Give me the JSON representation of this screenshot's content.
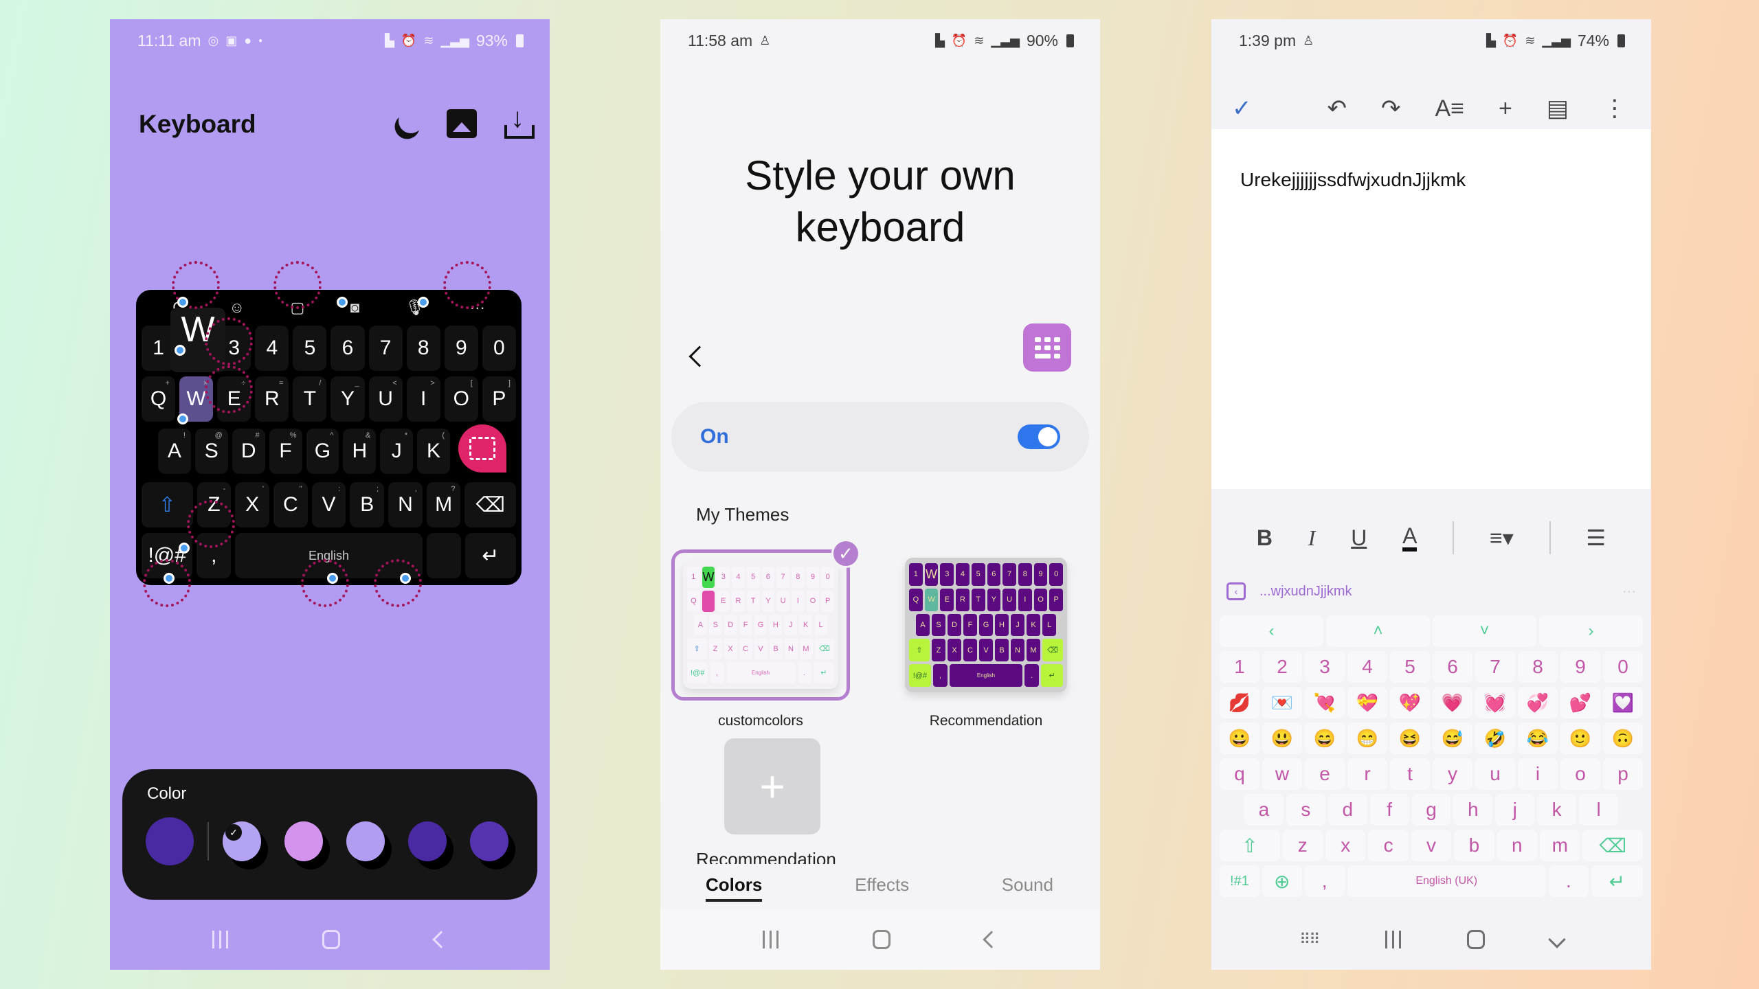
{
  "phone1": {
    "status": {
      "time": "11:11 am",
      "battery": "93%",
      "left_icons": [
        "whatsapp-icon",
        "gallery-icon",
        "chat-icon",
        "dot"
      ],
      "right_icons": [
        "sim-icon",
        "alarm-icon",
        "wifi-icon",
        "volte-lte1",
        "volte-lte2"
      ]
    },
    "title": "Keyboard",
    "actions": [
      "dark-mode",
      "background-image",
      "download"
    ],
    "preview_key": "W",
    "toolbar_icons": [
      "clipboard",
      "emoji",
      "sticker",
      "screenshot",
      "mic",
      "more"
    ],
    "rows": [
      [
        {
          "k": "1"
        },
        {
          "k": "2"
        },
        {
          "k": "3"
        },
        {
          "k": "4"
        },
        {
          "k": "5"
        },
        {
          "k": "6"
        },
        {
          "k": "7"
        },
        {
          "k": "8"
        },
        {
          "k": "9"
        },
        {
          "k": "0"
        }
      ],
      [
        {
          "k": "Q",
          "s": "+"
        },
        {
          "k": "W",
          "s": "×"
        },
        {
          "k": "E",
          "s": "÷"
        },
        {
          "k": "R",
          "s": "="
        },
        {
          "k": "T",
          "s": "/"
        },
        {
          "k": "Y",
          "s": "_"
        },
        {
          "k": "U",
          "s": "<"
        },
        {
          "k": "I",
          "s": ">"
        },
        {
          "k": "O",
          "s": "["
        },
        {
          "k": "P",
          "s": "]"
        }
      ],
      [
        {
          "k": "A",
          "s": "!"
        },
        {
          "k": "S",
          "s": "@"
        },
        {
          "k": "D",
          "s": "#"
        },
        {
          "k": "F",
          "s": "%"
        },
        {
          "k": "G",
          "s": "^"
        },
        {
          "k": "H",
          "s": "&"
        },
        {
          "k": "J",
          "s": "*"
        },
        {
          "k": "K",
          "s": "("
        }
      ],
      [
        {
          "k": "⇧"
        },
        {
          "k": "Z",
          "s": "-"
        },
        {
          "k": "X",
          "s": "'"
        },
        {
          "k": "C",
          "s": "\""
        },
        {
          "k": "V",
          "s": ":"
        },
        {
          "k": "B",
          "s": ";"
        },
        {
          "k": "N",
          "s": ","
        },
        {
          "k": "M",
          "s": "?"
        },
        {
          "k": "⌫"
        }
      ],
      [
        {
          "k": "!@#"
        },
        {
          "k": ","
        },
        {
          "k": "English"
        },
        {
          "k": ""
        },
        {
          "k": "↵"
        }
      ]
    ],
    "color_panel": {
      "label": "Color",
      "current": "#4a2aa3",
      "swatches": [
        {
          "color": "#b3a3f2",
          "selected": true
        },
        {
          "color": "#d393ee",
          "selected": false
        },
        {
          "color": "#b19ef2",
          "selected": false
        },
        {
          "color": "#4a2aa3",
          "selected": false
        },
        {
          "color": "#5532b0",
          "selected": false
        }
      ]
    }
  },
  "phone2": {
    "status": {
      "time": "11:58 am",
      "battery": "90%"
    },
    "title_line1": "Style your own",
    "title_line2": "keyboard",
    "toggle_label": "On",
    "toggle_on": true,
    "section_title": "My Themes",
    "themes": [
      {
        "name": "customcolors",
        "selected": true
      },
      {
        "name": "Recommendation",
        "selected": false
      }
    ],
    "add_label": "+",
    "partial_label": "Recommendation",
    "tabs": [
      {
        "label": "Colors",
        "active": true
      },
      {
        "label": "Effects",
        "active": false
      },
      {
        "label": "Sound",
        "active": false
      }
    ],
    "preview_rows": [
      [
        "1",
        "W",
        "3",
        "4",
        "5",
        "6",
        "7",
        "8",
        "9",
        "0"
      ],
      [
        "Q",
        "W",
        "E",
        "R",
        "T",
        "Y",
        "U",
        "I",
        "O",
        "P"
      ],
      [
        "A",
        "S",
        "D",
        "F",
        "G",
        "H",
        "J",
        "K",
        "L"
      ],
      [
        "⇧",
        "Z",
        "X",
        "C",
        "V",
        "B",
        "N",
        "M",
        "⌫"
      ],
      [
        "!@#",
        ",",
        "English",
        ".",
        "↵"
      ]
    ]
  },
  "phone3": {
    "status": {
      "time": "1:39 pm",
      "battery": "74%"
    },
    "toolbar": [
      "done",
      "undo",
      "redo",
      "text-format",
      "insert",
      "comment",
      "more"
    ],
    "document_text": "UrekejjjjjjssdfwjxudnJjjkmk",
    "format_bar": [
      "B",
      "I",
      "U",
      "A",
      "align",
      "list"
    ],
    "suggestion": "...wjxudnJjjkmk",
    "arrow_row": [
      "‹",
      "˄",
      "˅",
      "›"
    ],
    "number_row": [
      "1",
      "2",
      "3",
      "4",
      "5",
      "6",
      "7",
      "8",
      "9",
      "0"
    ],
    "emoji_row_1": [
      "💋",
      "💌",
      "💘",
      "💝",
      "💖",
      "💗",
      "💓",
      "💞",
      "💕",
      "💟"
    ],
    "emoji_row_2": [
      "😀",
      "😃",
      "😄",
      "😁",
      "😆",
      "😅",
      "🤣",
      "😂",
      "🙂",
      "🙃"
    ],
    "row_q": [
      "q",
      "w",
      "e",
      "r",
      "t",
      "y",
      "u",
      "i",
      "o",
      "p"
    ],
    "row_a": [
      "a",
      "s",
      "d",
      "f",
      "g",
      "h",
      "j",
      "k",
      "l"
    ],
    "row_z": [
      "z",
      "x",
      "c",
      "v",
      "b",
      "n",
      "m"
    ],
    "bottom_row": {
      "symbols": "!#1",
      "comma": ",",
      "space": "English (UK)",
      "period": "."
    }
  }
}
